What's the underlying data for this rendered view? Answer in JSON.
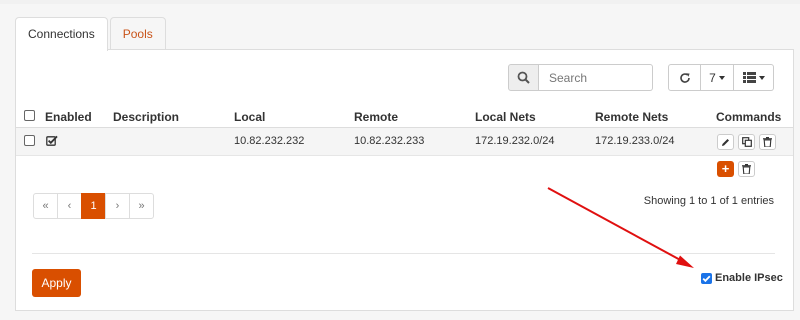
{
  "tabs": [
    {
      "label": "Connections",
      "active": true
    },
    {
      "label": "Pools",
      "active": false
    }
  ],
  "search": {
    "placeholder": "Search",
    "value": ""
  },
  "toolbar": {
    "rows_per_page": "7"
  },
  "table": {
    "columns": [
      "Enabled",
      "Description",
      "Local",
      "Remote",
      "Local Nets",
      "Remote Nets",
      "Commands"
    ],
    "rows": [
      {
        "enabled": true,
        "description": "",
        "local": "10.82.232.232",
        "remote": "10.82.232.233",
        "local_nets": "172.19.232.0/24",
        "remote_nets": "172.19.233.0/24"
      }
    ]
  },
  "pagination": {
    "first": "«",
    "prev": "‹",
    "current": "1",
    "next": "›",
    "last": "»",
    "summary": "Showing 1 to 1 of 1 entries"
  },
  "footer": {
    "apply_label": "Apply",
    "enable_ipsec_label": "Enable IPsec",
    "enable_ipsec_checked": true
  },
  "colors": {
    "accent": "#d94f00",
    "annotation_arrow": "#e01010"
  }
}
